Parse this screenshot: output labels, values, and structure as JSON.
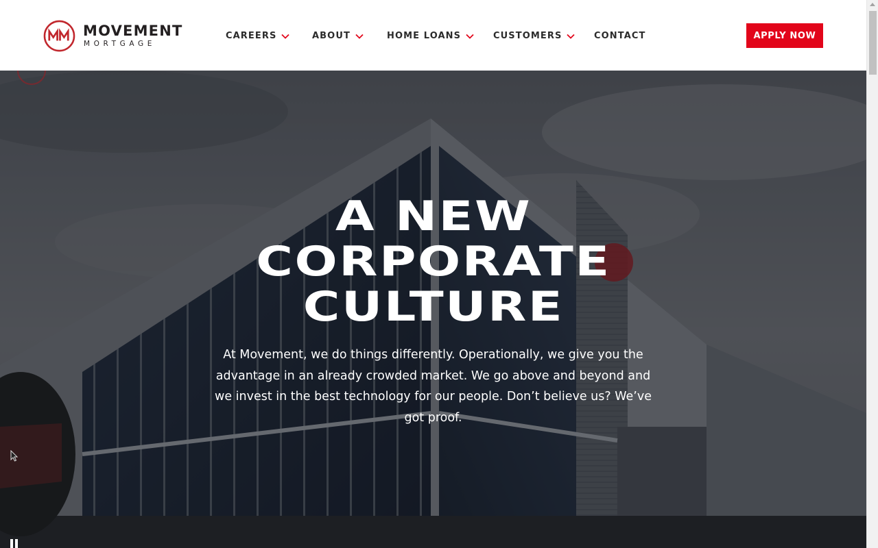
{
  "brand": {
    "name": "MOVEMENT",
    "sub": "MORTGAGE",
    "mark_letters": "MM",
    "accent_color": "#e2051a",
    "text_color": "#231f20"
  },
  "nav": {
    "items": [
      {
        "label": "CAREERS",
        "has_dropdown": true
      },
      {
        "label": "ABOUT",
        "has_dropdown": true
      },
      {
        "label": "HOME LOANS",
        "has_dropdown": true
      },
      {
        "label": "CUSTOMERS",
        "has_dropdown": true
      },
      {
        "label": "CONTACT",
        "has_dropdown": false
      }
    ],
    "cta_label": "APPLY NOW"
  },
  "hero": {
    "title_lines": [
      "A NEW",
      "CORPORATE",
      "CULTURE"
    ],
    "body": "At Movement, we do things differently. Operationally, we give you the advantage in an already crowded market. We go above and beyond and we invest in the best technology for our people. Don’t believe us? We’ve got proof.",
    "video_control_icon": "pause-icon",
    "background_icon": "office-building-photo"
  }
}
